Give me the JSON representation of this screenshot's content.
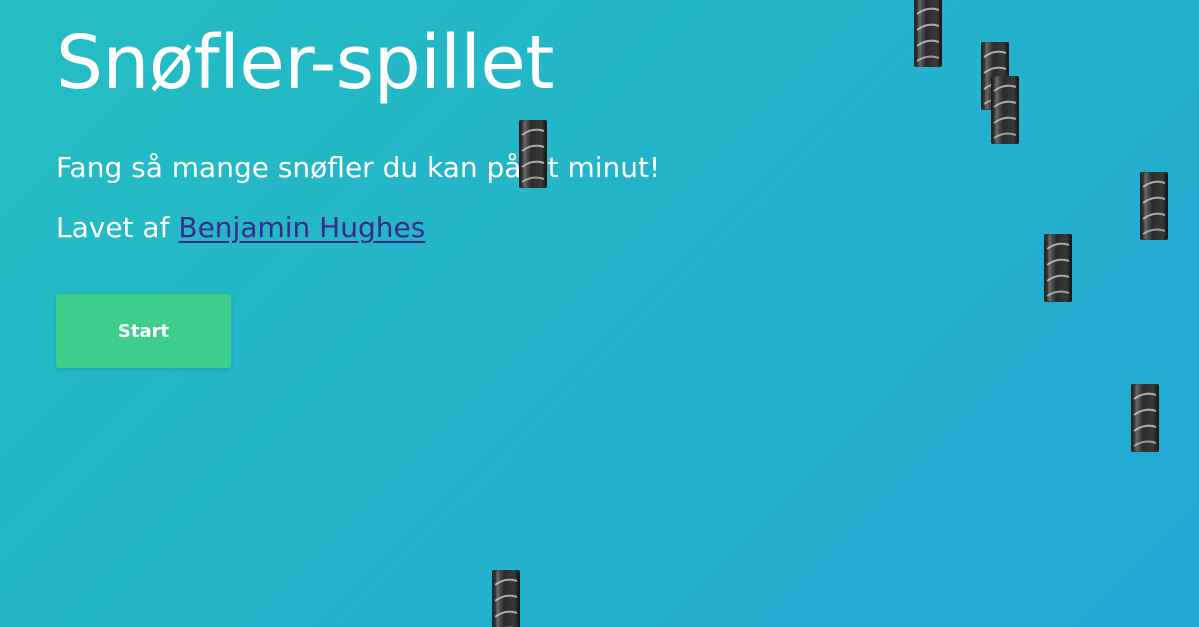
{
  "page": {
    "title": "Snøfler-spillet",
    "tagline": "Fang så mange snøfler du kan på et minut!",
    "credit_prefix": "Lavet af ",
    "credit_name": "Benjamin Hughes"
  },
  "start_button": {
    "label": "Start"
  },
  "colors": {
    "background_start": "#25BEC2",
    "background_end": "#22A8D4",
    "text": "#FFFFFF",
    "link": "#3B2A8C",
    "start_button": "#3ECD8A"
  },
  "snofler": {
    "icon": "licorice-roll-icon",
    "count": 9
  }
}
